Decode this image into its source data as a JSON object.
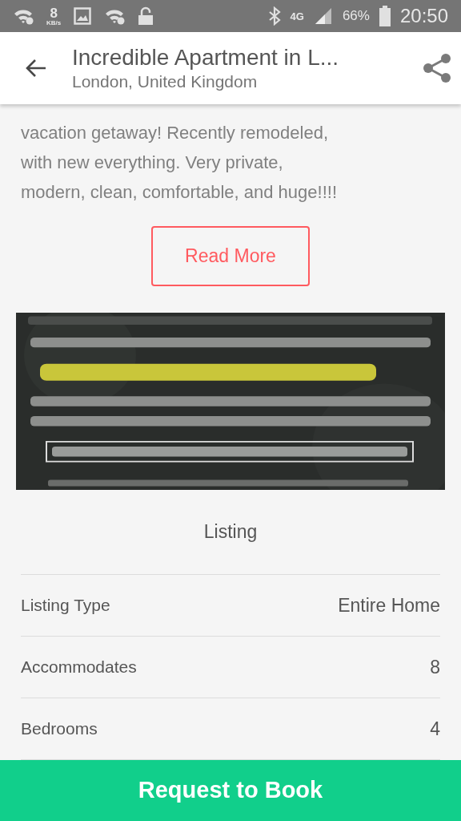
{
  "status_bar": {
    "speed": "8",
    "speed_unit": "KB/s",
    "network": "4G",
    "battery": "66%",
    "time": "20:50"
  },
  "header": {
    "title": "Incredible Apartment in L...",
    "subtitle": "London, United Kingdom"
  },
  "description": {
    "lines": [
      "vacation getaway! Recently remodeled,",
      "with new everything. Very private,",
      "modern, clean, comfortable, and huge!!!!"
    ],
    "button": "Read More"
  },
  "listing": {
    "heading": "Listing",
    "rows": [
      {
        "label": "Listing Type",
        "value": "Entire Home"
      },
      {
        "label": "Accommodates",
        "value": "8"
      },
      {
        "label": "Bedrooms",
        "value": "4"
      }
    ]
  },
  "book_button": "Request to Book"
}
